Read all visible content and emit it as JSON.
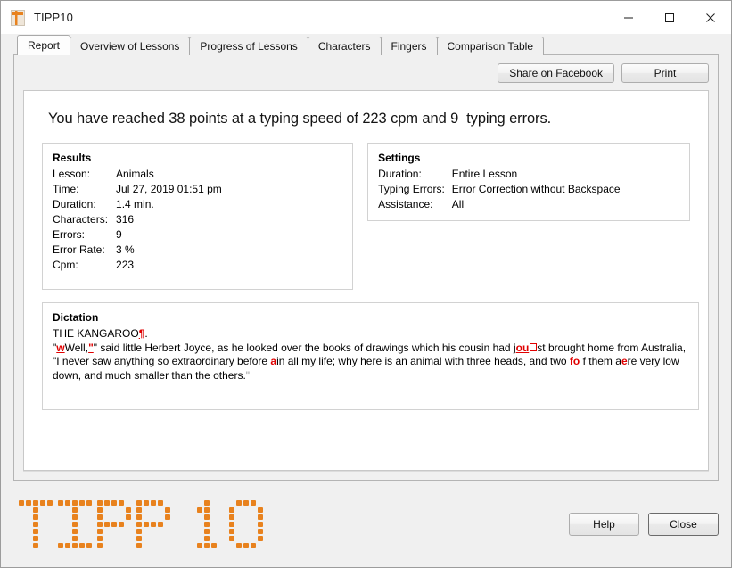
{
  "window": {
    "title": "TIPP10",
    "icon": "app-icon",
    "controls": {
      "minimize": "minimize-icon",
      "maximize": "maximize-icon",
      "close": "close-icon"
    }
  },
  "tabs": [
    {
      "label": "Report",
      "active": true
    },
    {
      "label": "Overview of Lessons",
      "active": false
    },
    {
      "label": "Progress of Lessons",
      "active": false
    },
    {
      "label": "Characters",
      "active": false
    },
    {
      "label": "Fingers",
      "active": false
    },
    {
      "label": "Comparison Table",
      "active": false
    }
  ],
  "toolbar": {
    "share_label": "Share on Facebook",
    "print_label": "Print"
  },
  "report": {
    "headline": "You have reached 38 points at a typing speed of 223 cpm and 9  typing errors.",
    "points": "38",
    "cpm": "223",
    "errors": "9"
  },
  "results": {
    "title": "Results",
    "rows": [
      {
        "key": "Lesson:",
        "value": "Animals"
      },
      {
        "key": "Time:",
        "value": "Jul 27, 2019 01:51 pm"
      },
      {
        "key": "Duration:",
        "value": "1.4 min."
      },
      {
        "key": "Characters:",
        "value": "316"
      },
      {
        "key": "Errors:",
        "value": "9"
      },
      {
        "key": "Error Rate:",
        "value": "3 %"
      },
      {
        "key": "Cpm:",
        "value": "223"
      }
    ]
  },
  "settings": {
    "title": "Settings",
    "rows": [
      {
        "key": "Duration:",
        "value": "Entire Lesson"
      },
      {
        "key": "Typing Errors:",
        "value": "Error Correction without Backspace"
      },
      {
        "key": "Assistance:",
        "value": "All"
      }
    ]
  },
  "dictation": {
    "title": "Dictation",
    "plain_text": "THE KANGAROO¶.\n\"wWell,\"\" said little Herbert Joyce, as he looked over the books of drawings which his cousin had jou□st brought home from Australia, \"I never saw anything so extraordinary before ain all my life; why here is an animal with three heads, and two fo f them aere very low down, and much smaller than the others.\"",
    "segments": [
      {
        "t": "THE KANGAROO",
        "k": "plain"
      },
      {
        "t": "¶",
        "k": "err"
      },
      {
        "t": ".\n",
        "k": "plain"
      },
      {
        "t": "\"",
        "k": "plain"
      },
      {
        "t": "w",
        "k": "err"
      },
      {
        "t": "Well,",
        "k": "plain"
      },
      {
        "t": "\"",
        "k": "err"
      },
      {
        "t": "\" said little Herbert Joyce, as he looked over the books of drawings which his cousin had j",
        "k": "plain"
      },
      {
        "t": "ou",
        "k": "err"
      },
      {
        "t": "□",
        "k": "box"
      },
      {
        "t": "st brought home from Australia, \"I never saw anything so extraordinary before ",
        "k": "plain"
      },
      {
        "t": "a",
        "k": "err"
      },
      {
        "t": "in all my life; why here is an animal with three heads, and two ",
        "k": "plain"
      },
      {
        "t": "fo",
        "k": "err"
      },
      {
        "t": " f",
        "k": "ins"
      },
      {
        "t": " them a",
        "k": "plain"
      },
      {
        "t": "e",
        "k": "err"
      },
      {
        "t": "re very low down, and much smaller than the others.",
        "k": "plain"
      },
      {
        "t": "\"",
        "k": "faint"
      }
    ]
  },
  "footer": {
    "logo_text": "TIPP 10",
    "help_label": "Help",
    "close_label": "Close"
  },
  "colors": {
    "brand_orange": "#e8821e",
    "error_red": "#e00000",
    "window_bg": "#f0f0f0",
    "card_bg": "#ffffff"
  }
}
